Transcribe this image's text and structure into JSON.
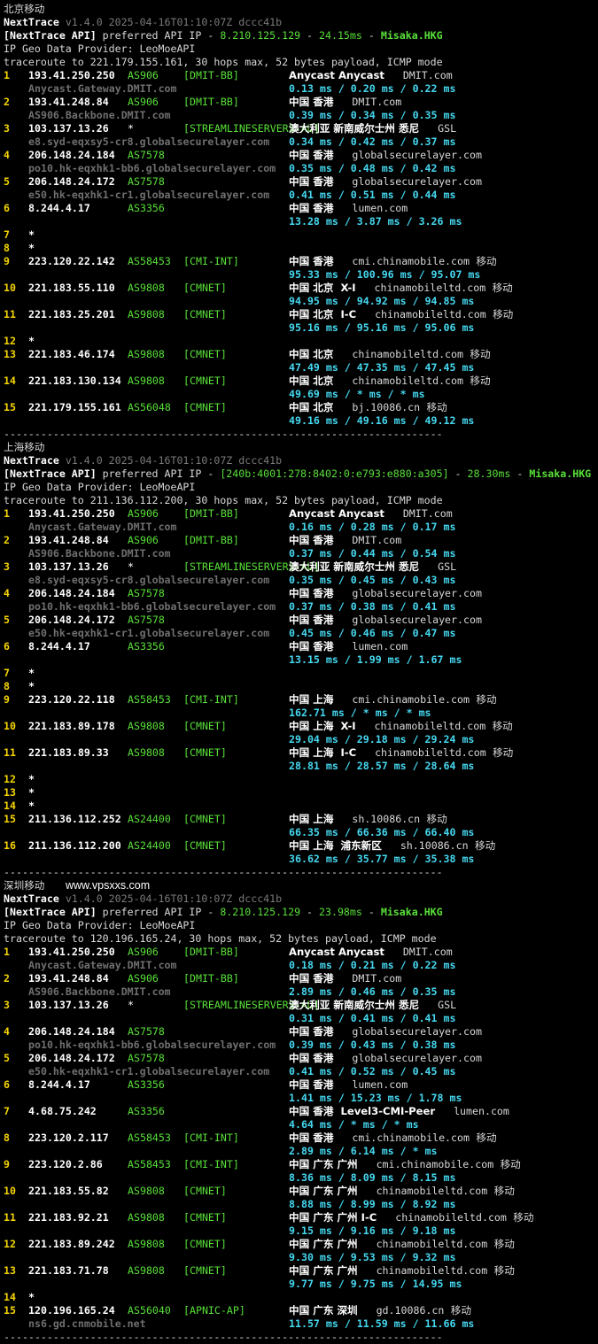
{
  "colors": {
    "hop": "#f5d400",
    "asn": "#58e038",
    "tag": "#58e038",
    "hostname": "#6f6f6f",
    "latency": "#45d8f0",
    "text": "#d8d8d8",
    "white": "#ffffff",
    "version": "#7a7a7a",
    "ip_hl": "#58e038"
  },
  "sections": [
    {
      "title": "北京移动",
      "website": "",
      "version": "v1.4.0 2025-04-16T01:10:07Z dccc41b",
      "api_label": "[NextTrace API]",
      "api_text": " preferred API IP - ",
      "api_ip": "8.210.125.129",
      "api_latency": "24.15ms",
      "api_node": "Misaka.HKG",
      "provider": "IP Geo Data Provider: LeoMoeAPI",
      "traceroute": "traceroute to 221.179.155.161, 30 hops max, 52 bytes payload, ICMP mode",
      "hops": [
        {
          "n": "1",
          "ip": "193.41.250.250",
          "asn": "AS906",
          "tag": "[DMIT-BB]",
          "geo": "Anycast Anycast",
          "geo_bold": true,
          "dom": "DMIT.com",
          "isp": "",
          "host": "Anycast.Gateway.DMIT.com",
          "lat": "0.13 ms / 0.20 ms / 0.22 ms"
        },
        {
          "n": "2",
          "ip": "193.41.248.84",
          "asn": "AS906",
          "tag": "[DMIT-BB]",
          "geo": "中国 香港",
          "geo_bold": true,
          "dom": "DMIT.com",
          "isp": "",
          "host": "AS906.Backbone.DMIT.com",
          "lat": "0.39 ms / 0.34 ms / 0.35 ms"
        },
        {
          "n": "3",
          "ip": "103.137.13.26",
          "asn": "*",
          "tag": "[STREAMLINESERVERS-AU]",
          "geo": "澳大利亚 新南威尔士州 悉尼",
          "geo_bold": true,
          "dom": "GSL",
          "isp": "",
          "host": "e8.syd-eqxsy5-cr8.globalsecurelayer.com",
          "lat": "0.34 ms / 0.42 ms / 0.37 ms"
        },
        {
          "n": "4",
          "ip": "206.148.24.184",
          "asn": "AS7578",
          "tag": "",
          "geo": "中国 香港",
          "geo_bold": true,
          "dom": "globalsecurelayer.com",
          "isp": "",
          "host": "po10.hk-eqxhk1-bb6.globalsecurelayer.com",
          "lat": "0.35 ms / 0.48 ms / 0.42 ms"
        },
        {
          "n": "5",
          "ip": "206.148.24.172",
          "asn": "AS7578",
          "tag": "",
          "geo": "中国 香港",
          "geo_bold": true,
          "dom": "globalsecurelayer.com",
          "isp": "",
          "host": "e50.hk-eqxhk1-cr1.globalsecurelayer.com",
          "lat": "0.41 ms / 0.51 ms / 0.44 ms"
        },
        {
          "n": "6",
          "ip": "8.244.4.17",
          "asn": "AS3356",
          "tag": "",
          "geo": "中国 香港",
          "geo_bold": true,
          "dom": "lumen.com",
          "isp": "",
          "host": "",
          "lat": "13.28 ms / 3.87 ms / 3.26 ms"
        },
        {
          "n": "7",
          "ip": "*",
          "asn": "",
          "tag": "",
          "geo": "",
          "dom": "",
          "isp": "",
          "host": "",
          "lat": ""
        },
        {
          "n": "8",
          "ip": "*",
          "asn": "",
          "tag": "",
          "geo": "",
          "dom": "",
          "isp": "",
          "host": "",
          "lat": ""
        },
        {
          "n": "9",
          "ip": "223.120.22.142",
          "asn": "AS58453",
          "tag": "[CMI-INT]",
          "geo": "中国 香港",
          "geo_bold": true,
          "dom": "cmi.chinamobile.com",
          "isp": "移动",
          "host": "",
          "lat": "95.33 ms / 100.96 ms / 95.07 ms"
        },
        {
          "n": "10",
          "ip": "221.183.55.110",
          "asn": "AS9808",
          "tag": "[CMNET]",
          "geo": "中国 北京  X-I",
          "geo_bold": true,
          "dom": "chinamobileltd.com",
          "isp": "移动",
          "host": "",
          "lat": "94.95 ms / 94.92 ms / 94.85 ms"
        },
        {
          "n": "11",
          "ip": "221.183.25.201",
          "asn": "AS9808",
          "tag": "[CMNET]",
          "geo": "中国 北京  I-C",
          "geo_bold": true,
          "dom": "chinamobileltd.com",
          "isp": "移动",
          "host": "",
          "lat": "95.16 ms / 95.16 ms / 95.06 ms"
        },
        {
          "n": "12",
          "ip": "*",
          "asn": "",
          "tag": "",
          "geo": "",
          "dom": "",
          "isp": "",
          "host": "",
          "lat": ""
        },
        {
          "n": "13",
          "ip": "221.183.46.174",
          "asn": "AS9808",
          "tag": "[CMNET]",
          "geo": "中国 北京",
          "geo_bold": true,
          "dom": "chinamobileltd.com",
          "isp": "移动",
          "host": "",
          "lat": "47.49 ms / 47.35 ms / 47.45 ms"
        },
        {
          "n": "14",
          "ip": "221.183.130.134",
          "asn": "AS9808",
          "tag": "[CMNET]",
          "geo": "中国 北京",
          "geo_bold": true,
          "dom": "chinamobileltd.com",
          "isp": "移动",
          "host": "",
          "lat": "49.69 ms / * ms / * ms"
        },
        {
          "n": "15",
          "ip": "221.179.155.161",
          "asn": "AS56048",
          "tag": "[CMNET]",
          "geo": "中国 北京",
          "geo_bold": true,
          "dom": "bj.10086.cn",
          "isp": "移动",
          "host": "",
          "lat": "49.16 ms / 49.16 ms / 49.12 ms"
        }
      ]
    },
    {
      "title": "上海移动",
      "website": "",
      "version": "v1.4.0 2025-04-16T01:10:07Z dccc41b",
      "api_label": "[NextTrace API]",
      "api_text": " preferred API IP - ",
      "api_ip": "[240b:4001:278:8402:0:e793:e880:a305]",
      "api_latency": "28.30ms",
      "api_node": "Misaka.HKG",
      "provider": "IP Geo Data Provider: LeoMoeAPI",
      "traceroute": "traceroute to 211.136.112.200, 30 hops max, 52 bytes payload, ICMP mode",
      "hops": [
        {
          "n": "1",
          "ip": "193.41.250.250",
          "asn": "AS906",
          "tag": "[DMIT-BB]",
          "geo": "Anycast Anycast",
          "geo_bold": true,
          "dom": "DMIT.com",
          "isp": "",
          "host": "Anycast.Gateway.DMIT.com",
          "lat": "0.16 ms / 0.28 ms / 0.17 ms"
        },
        {
          "n": "2",
          "ip": "193.41.248.84",
          "asn": "AS906",
          "tag": "[DMIT-BB]",
          "geo": "中国 香港",
          "geo_bold": true,
          "dom": "DMIT.com",
          "isp": "",
          "host": "AS906.Backbone.DMIT.com",
          "lat": "0.37 ms / 0.44 ms / 0.54 ms"
        },
        {
          "n": "3",
          "ip": "103.137.13.26",
          "asn": "*",
          "tag": "[STREAMLINESERVERS-AU]",
          "geo": "澳大利亚 新南威尔士州 悉尼",
          "geo_bold": true,
          "dom": "GSL",
          "isp": "",
          "host": "e8.syd-eqxsy5-cr8.globalsecurelayer.com",
          "lat": "0.35 ms / 0.45 ms / 0.43 ms"
        },
        {
          "n": "4",
          "ip": "206.148.24.184",
          "asn": "AS7578",
          "tag": "",
          "geo": "中国 香港",
          "geo_bold": true,
          "dom": "globalsecurelayer.com",
          "isp": "",
          "host": "po10.hk-eqxhk1-bb6.globalsecurelayer.com",
          "lat": "0.37 ms / 0.38 ms / 0.41 ms"
        },
        {
          "n": "5",
          "ip": "206.148.24.172",
          "asn": "AS7578",
          "tag": "",
          "geo": "中国 香港",
          "geo_bold": true,
          "dom": "globalsecurelayer.com",
          "isp": "",
          "host": "e50.hk-eqxhk1-cr1.globalsecurelayer.com",
          "lat": "0.45 ms / 0.46 ms / 0.47 ms"
        },
        {
          "n": "6",
          "ip": "8.244.4.17",
          "asn": "AS3356",
          "tag": "",
          "geo": "中国 香港",
          "geo_bold": true,
          "dom": "lumen.com",
          "isp": "",
          "host": "",
          "lat": "13.15 ms / 1.99 ms / 1.67 ms"
        },
        {
          "n": "7",
          "ip": "*",
          "asn": "",
          "tag": "",
          "geo": "",
          "dom": "",
          "isp": "",
          "host": "",
          "lat": ""
        },
        {
          "n": "8",
          "ip": "*",
          "asn": "",
          "tag": "",
          "geo": "",
          "dom": "",
          "isp": "",
          "host": "",
          "lat": ""
        },
        {
          "n": "9",
          "ip": "223.120.22.118",
          "asn": "AS58453",
          "tag": "[CMI-INT]",
          "geo": "中国 上海",
          "geo_bold": true,
          "dom": "cmi.chinamobile.com",
          "isp": "移动",
          "host": "",
          "lat": "162.71 ms / * ms / * ms"
        },
        {
          "n": "10",
          "ip": "221.183.89.178",
          "asn": "AS9808",
          "tag": "[CMNET]",
          "geo": "中国 上海  X-I",
          "geo_bold": true,
          "dom": "chinamobileltd.com",
          "isp": "移动",
          "host": "",
          "lat": "29.04 ms / 29.18 ms / 29.24 ms"
        },
        {
          "n": "11",
          "ip": "221.183.89.33",
          "asn": "AS9808",
          "tag": "[CMNET]",
          "geo": "中国 上海  I-C",
          "geo_bold": true,
          "dom": "chinamobileltd.com",
          "isp": "移动",
          "host": "",
          "lat": "28.81 ms / 28.57 ms / 28.64 ms"
        },
        {
          "n": "12",
          "ip": "*",
          "asn": "",
          "tag": "",
          "geo": "",
          "dom": "",
          "isp": "",
          "host": "",
          "lat": ""
        },
        {
          "n": "13",
          "ip": "*",
          "asn": "",
          "tag": "",
          "geo": "",
          "dom": "",
          "isp": "",
          "host": "",
          "lat": ""
        },
        {
          "n": "14",
          "ip": "*",
          "asn": "",
          "tag": "",
          "geo": "",
          "dom": "",
          "isp": "",
          "host": "",
          "lat": ""
        },
        {
          "n": "15",
          "ip": "211.136.112.252",
          "asn": "AS24400",
          "tag": "[CMNET]",
          "geo": "中国 上海",
          "geo_bold": true,
          "dom": "sh.10086.cn",
          "isp": "移动",
          "host": "",
          "lat": "66.35 ms / 66.36 ms / 66.40 ms"
        },
        {
          "n": "16",
          "ip": "211.136.112.200",
          "asn": "AS24400",
          "tag": "[CMNET]",
          "geo": "中国 上海  浦东新区",
          "geo_bold": true,
          "dom": "sh.10086.cn",
          "isp": "移动",
          "host": "",
          "lat": "36.62 ms / 35.77 ms / 35.38 ms"
        }
      ]
    },
    {
      "title": "深圳移动",
      "website": "www.vpsxxs.com",
      "version": "v1.4.0 2025-04-16T01:10:07Z dccc41b",
      "api_label": "[NextTrace API]",
      "api_text": " preferred API IP - ",
      "api_ip": "8.210.125.129",
      "api_latency": "23.98ms",
      "api_node": "Misaka.HKG",
      "provider": "IP Geo Data Provider: LeoMoeAPI",
      "traceroute": "traceroute to 120.196.165.24, 30 hops max, 52 bytes payload, ICMP mode",
      "hops": [
        {
          "n": "1",
          "ip": "193.41.250.250",
          "asn": "AS906",
          "tag": "[DMIT-BB]",
          "geo": "Anycast Anycast",
          "geo_bold": true,
          "dom": "DMIT.com",
          "isp": "",
          "host": "Anycast.Gateway.DMIT.com",
          "lat": "0.18 ms / 0.21 ms / 0.22 ms"
        },
        {
          "n": "2",
          "ip": "193.41.248.84",
          "asn": "AS906",
          "tag": "[DMIT-BB]",
          "geo": "中国 香港",
          "geo_bold": true,
          "dom": "DMIT.com",
          "isp": "",
          "host": "AS906.Backbone.DMIT.com",
          "lat": "2.89 ms / 0.46 ms / 0.35 ms"
        },
        {
          "n": "3",
          "ip": "103.137.13.26",
          "asn": "*",
          "tag": "[STREAMLINESERVERS-AU]",
          "geo": "澳大利亚 新南威尔士州 悉尼",
          "geo_bold": true,
          "dom": "GSL",
          "isp": "",
          "host": "",
          "lat": "0.31 ms / 0.41 ms / 0.41 ms"
        },
        {
          "n": "4",
          "ip": "206.148.24.184",
          "asn": "AS7578",
          "tag": "",
          "geo": "中国 香港",
          "geo_bold": true,
          "dom": "globalsecurelayer.com",
          "isp": "",
          "host": "po10.hk-eqxhk1-bb6.globalsecurelayer.com",
          "lat": "0.39 ms / 0.43 ms / 0.38 ms"
        },
        {
          "n": "5",
          "ip": "206.148.24.172",
          "asn": "AS7578",
          "tag": "",
          "geo": "中国 香港",
          "geo_bold": true,
          "dom": "globalsecurelayer.com",
          "isp": "",
          "host": "e50.hk-eqxhk1-cr1.globalsecurelayer.com",
          "lat": "0.41 ms / 0.52 ms / 0.45 ms"
        },
        {
          "n": "6",
          "ip": "8.244.4.17",
          "asn": "AS3356",
          "tag": "",
          "geo": "中国 香港",
          "geo_bold": true,
          "dom": "lumen.com",
          "isp": "",
          "host": "",
          "lat": "1.41 ms / 15.23 ms / 1.78 ms"
        },
        {
          "n": "7",
          "ip": "4.68.75.242",
          "asn": "AS3356",
          "tag": "",
          "geo": "中国 香港  Level3-CMI-Peer",
          "geo_bold": true,
          "dom": "lumen.com",
          "isp": "",
          "host": "",
          "lat": "4.64 ms / * ms / * ms"
        },
        {
          "n": "8",
          "ip": "223.120.2.117",
          "asn": "AS58453",
          "tag": "[CMI-INT]",
          "geo": "中国 香港",
          "geo_bold": true,
          "dom": "cmi.chinamobile.com",
          "isp": "移动",
          "host": "",
          "lat": "2.89 ms / 6.14 ms / * ms"
        },
        {
          "n": "9",
          "ip": "223.120.2.86",
          "asn": "AS58453",
          "tag": "[CMI-INT]",
          "geo": "中国 广东 广州",
          "geo_bold": true,
          "dom": "cmi.chinamobile.com",
          "isp": "移动",
          "host": "",
          "lat": "8.36 ms / 8.09 ms / 8.15 ms"
        },
        {
          "n": "10",
          "ip": "221.183.55.82",
          "asn": "AS9808",
          "tag": "[CMNET]",
          "geo": "中国 广东 广州",
          "geo_bold": true,
          "dom": "chinamobileltd.com",
          "isp": "移动",
          "host": "",
          "lat": "8.88 ms / 8.99 ms / 8.92 ms"
        },
        {
          "n": "11",
          "ip": "221.183.92.21",
          "asn": "AS9808",
          "tag": "[CMNET]",
          "geo": "中国 广东 广州 I-C",
          "geo_bold": true,
          "dom": "chinamobileltd.com",
          "isp": "移动",
          "host": "",
          "lat": "9.15 ms / 9.16 ms / 9.18 ms"
        },
        {
          "n": "12",
          "ip": "221.183.89.242",
          "asn": "AS9808",
          "tag": "[CMNET]",
          "geo": "中国 广东 广州",
          "geo_bold": true,
          "dom": "chinamobileltd.com",
          "isp": "移动",
          "host": "",
          "lat": "9.30 ms / 9.53 ms / 9.32 ms"
        },
        {
          "n": "13",
          "ip": "221.183.71.78",
          "asn": "AS9808",
          "tag": "[CMNET]",
          "geo": "中国 广东 广州",
          "geo_bold": true,
          "dom": "chinamobileltd.com",
          "isp": "移动",
          "host": "",
          "lat": "9.77 ms / 9.75 ms / 14.95 ms"
        },
        {
          "n": "14",
          "ip": "*",
          "asn": "",
          "tag": "",
          "geo": "",
          "dom": "",
          "isp": "",
          "host": "",
          "lat": ""
        },
        {
          "n": "15",
          "ip": "120.196.165.24",
          "asn": "AS56040",
          "tag": "[APNIC-AP]",
          "geo": "中国 广东 深圳",
          "geo_bold": true,
          "dom": "gd.10086.cn",
          "isp": "移动",
          "host": "ns6.gd.cnmobile.net",
          "lat": "11.57 ms / 11.59 ms / 11.66 ms"
        }
      ]
    }
  ],
  "separator": "-----------------------------------------------------------------------"
}
